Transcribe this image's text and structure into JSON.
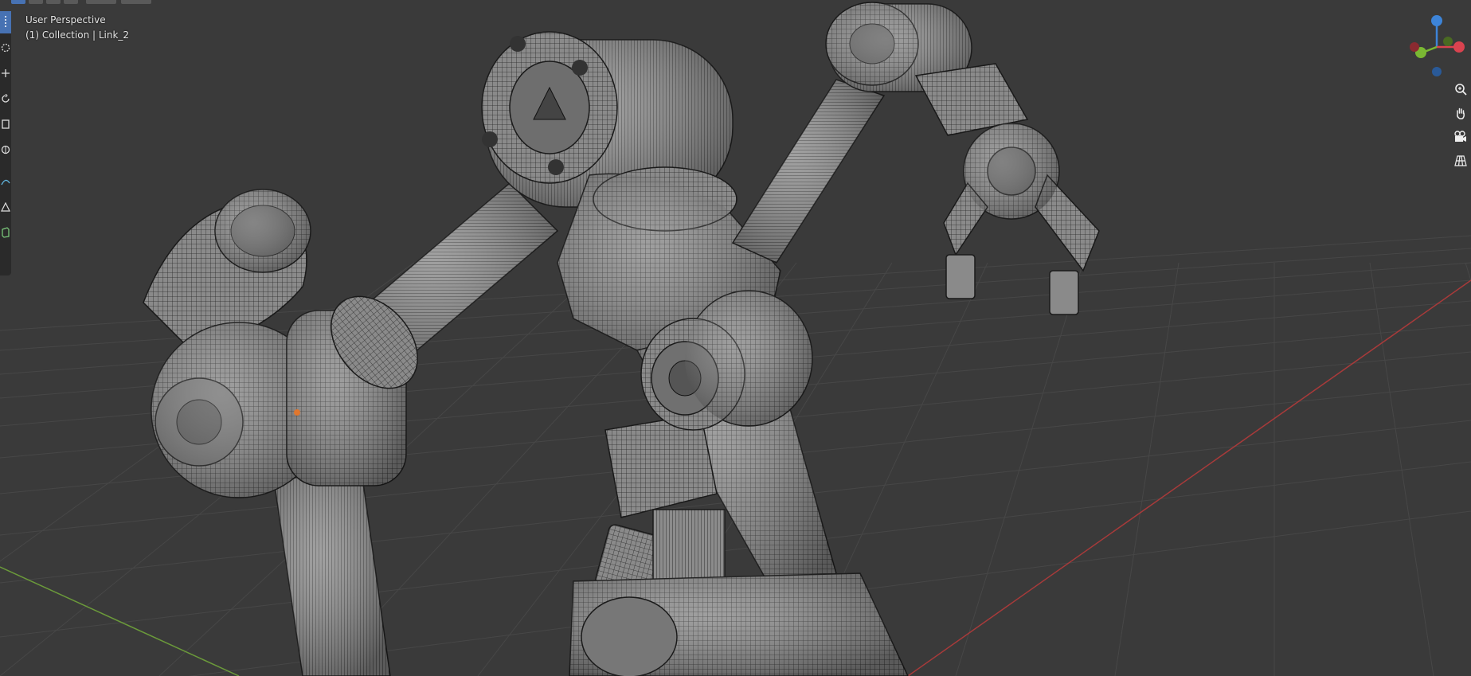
{
  "viewport": {
    "view_name": "User Perspective",
    "collection_label": "(1) Collection | Link_2",
    "colors": {
      "background": "#3a3a3a",
      "grid": "#474747",
      "x_axis": "#a83a3a",
      "y_axis": "#6b9a3a",
      "mesh_fill": "#8e8e8e",
      "wire": "#1a1a1a",
      "active_tool": "#4772b3"
    }
  },
  "toolbar": {
    "tools": [
      "select-box",
      "cursor",
      "move",
      "rotate",
      "scale",
      "transform",
      "annotate",
      "measure",
      "add-cube"
    ]
  },
  "gizmo": {
    "axes": [
      "X",
      "Y",
      "Z"
    ],
    "colors": {
      "x": "#d9434f",
      "y": "#7ab833",
      "z": "#3d84d8"
    }
  },
  "nav": {
    "buttons": [
      "zoom",
      "pan",
      "camera",
      "perspective-ortho"
    ]
  }
}
